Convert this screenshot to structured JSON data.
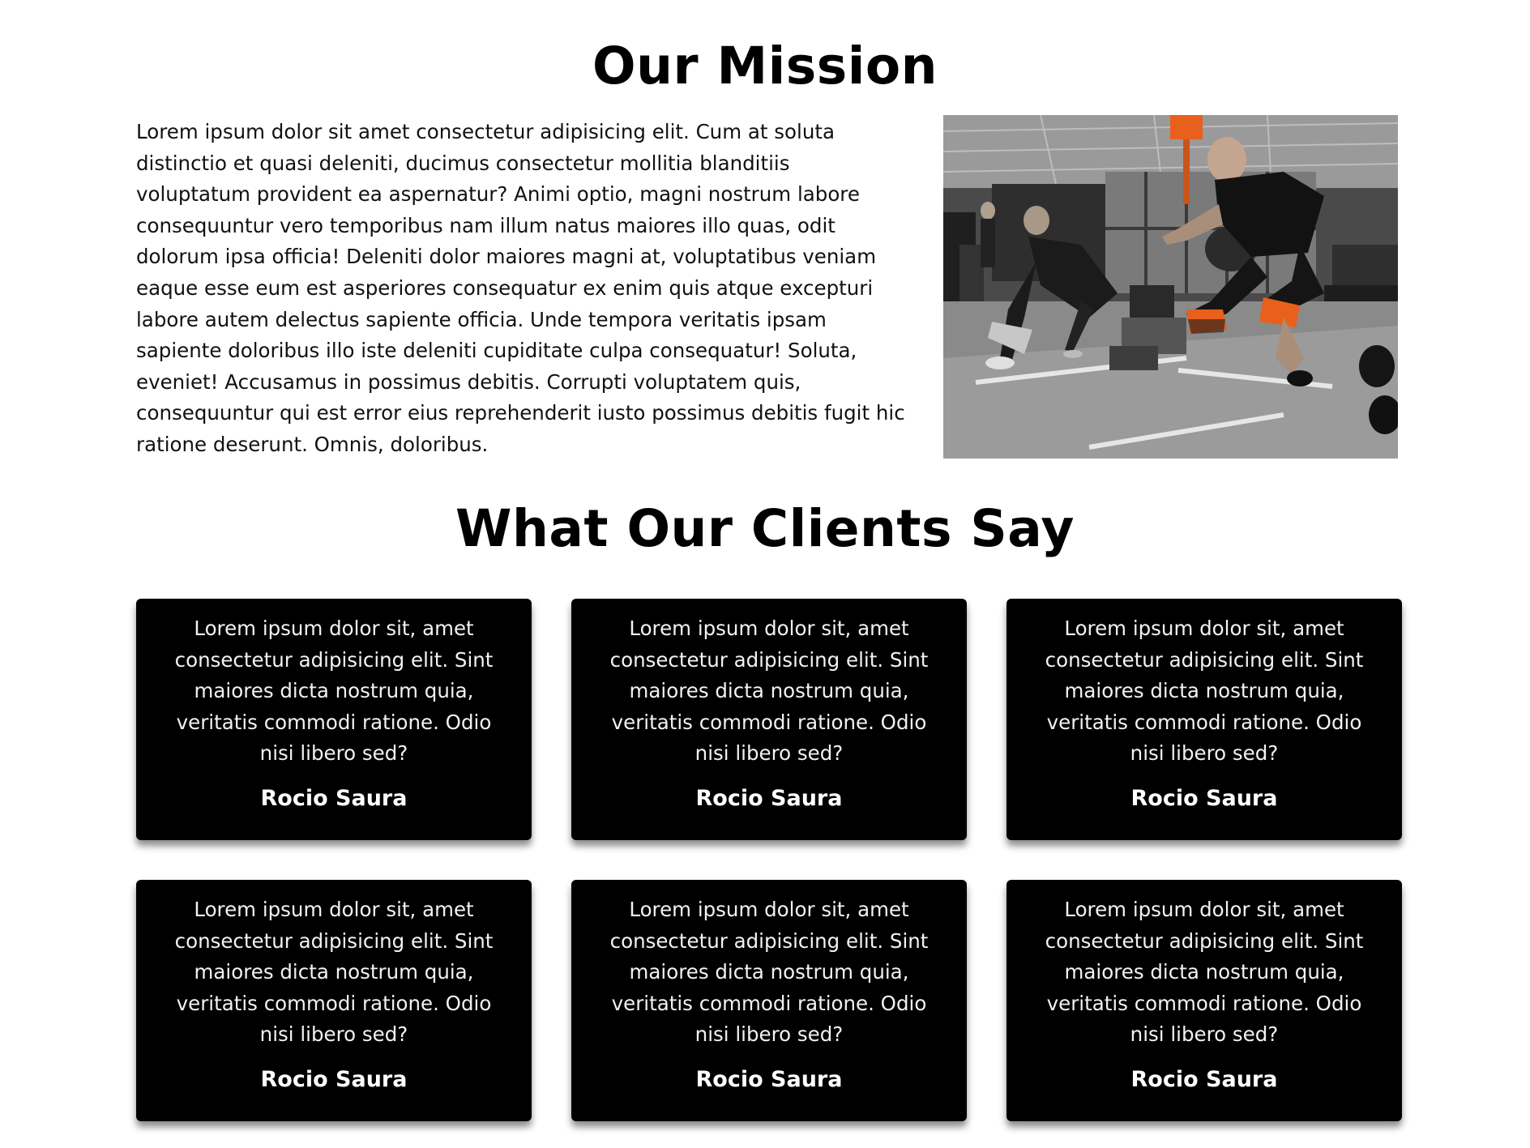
{
  "mission": {
    "title": "Our Mission",
    "body": "Lorem ipsum dolor sit amet consectetur adipisicing elit. Cum at soluta distinctio et quasi deleniti, ducimus consectetur mollitia blanditiis voluptatum provident ea aspernatur? Animi optio, magni nostrum labore consequuntur vero temporibus nam illum natus maiores illo quas, odit dolorum ipsa officia! Deleniti dolor maiores magni at, voluptatibus veniam eaque esse eum est asperiores consequatur ex enim quis atque excepturi labore autem delectus sapiente officia. Unde tempora veritatis ipsam sapiente doloribus illo iste deleniti cupiditate culpa consequatur! Soluta, eveniet! Accusamus in possimus debitis. Corrupti voluptatem quis, consequuntur qui est error eius reprehenderit iusto possimus debitis fugit hic ratione deserunt. Omnis, doloribus."
  },
  "testimonials": {
    "title": "What Our Clients Say",
    "items": [
      {
        "quote": "Lorem ipsum dolor sit, amet consectetur adipisicing elit. Sint maiores dicta nostrum quia, veritatis commodi ratione. Odio nisi libero sed?",
        "author": "Rocio Saura"
      },
      {
        "quote": "Lorem ipsum dolor sit, amet consectetur adipisicing elit. Sint maiores dicta nostrum quia, veritatis commodi ratione. Odio nisi libero sed?",
        "author": "Rocio Saura"
      },
      {
        "quote": "Lorem ipsum dolor sit, amet consectetur adipisicing elit. Sint maiores dicta nostrum quia, veritatis commodi ratione. Odio nisi libero sed?",
        "author": "Rocio Saura"
      },
      {
        "quote": "Lorem ipsum dolor sit, amet consectetur adipisicing elit. Sint maiores dicta nostrum quia, veritatis commodi ratione. Odio nisi libero sed?",
        "author": "Rocio Saura"
      },
      {
        "quote": "Lorem ipsum dolor sit, amet consectetur adipisicing elit. Sint maiores dicta nostrum quia, veritatis commodi ratione. Odio nisi libero sed?",
        "author": "Rocio Saura"
      },
      {
        "quote": "Lorem ipsum dolor sit, amet consectetur adipisicing elit. Sint maiores dicta nostrum quia, veritatis commodi ratione. Odio nisi libero sed?",
        "author": "Rocio Saura"
      }
    ]
  },
  "colors": {
    "card_background": "#000000",
    "page_background": "#ffffff",
    "accent_orange": "#e8601c"
  }
}
